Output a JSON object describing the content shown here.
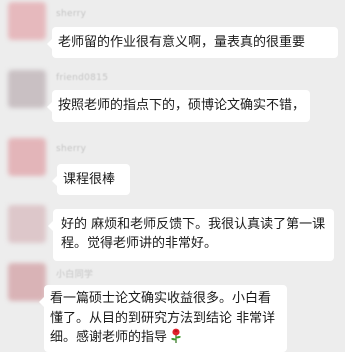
{
  "messages": [
    {
      "sender": "sherry",
      "text": "老师留的作业很有意义啊，量表真的很重要",
      "avatar_color": "#e6b9bd"
    },
    {
      "sender": "friend0815",
      "text": "按照老师的指点下的，硕博论文确实不错，",
      "avatar_color": "#c9c0c3"
    },
    {
      "sender": "sherry",
      "text": "课程很棒",
      "avatar_color": "#e3b5b9"
    },
    {
      "sender": "",
      "text": "好的 麻烦和老师反馈下。我很认真读了第一课程。觉得老师讲的非常好。",
      "avatar_color": "#ddc7ca"
    },
    {
      "sender": "小白同学",
      "text": "看一篇硕士论文确实收益很多。小白看懂了。从目的到研究方法到结论 非常详细。感谢老师的指导",
      "emoji": "rose-icon",
      "avatar_color": "#d9b3b6"
    }
  ]
}
